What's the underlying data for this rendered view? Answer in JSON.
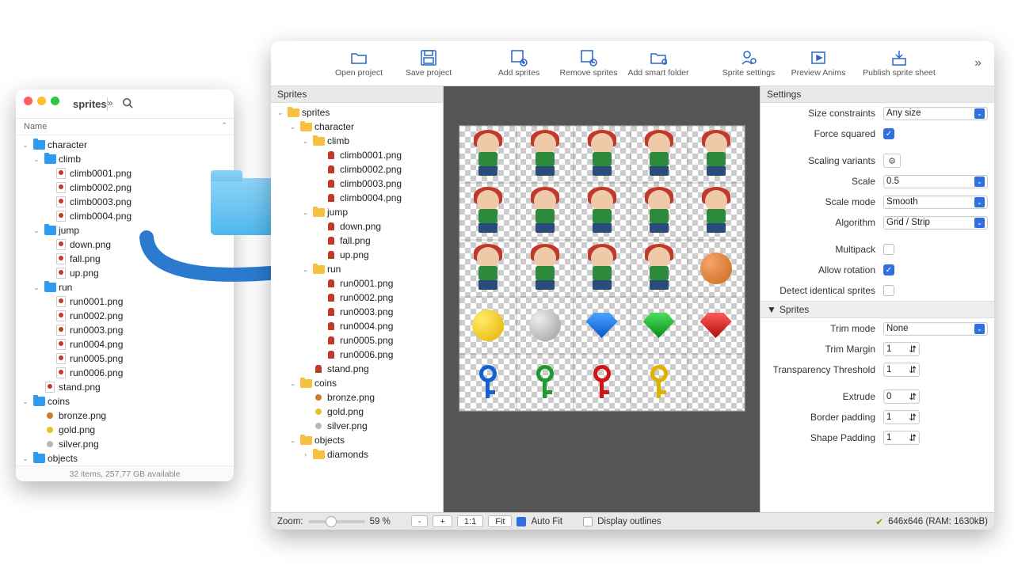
{
  "finder": {
    "title": "sprites",
    "name_header": "Name",
    "status": "32 items, 257,77 GB available",
    "tree": [
      {
        "d": 0,
        "t": "folder",
        "n": "character",
        "exp": 1
      },
      {
        "d": 1,
        "t": "folder",
        "n": "climb",
        "exp": 1
      },
      {
        "d": 2,
        "t": "png",
        "n": "climb0001.png"
      },
      {
        "d": 2,
        "t": "png",
        "n": "climb0002.png"
      },
      {
        "d": 2,
        "t": "png",
        "n": "climb0003.png"
      },
      {
        "d": 2,
        "t": "png",
        "n": "climb0004.png"
      },
      {
        "d": 1,
        "t": "folder",
        "n": "jump",
        "exp": 1
      },
      {
        "d": 2,
        "t": "png",
        "n": "down.png"
      },
      {
        "d": 2,
        "t": "png",
        "n": "fall.png"
      },
      {
        "d": 2,
        "t": "png",
        "n": "up.png"
      },
      {
        "d": 1,
        "t": "folder",
        "n": "run",
        "exp": 1
      },
      {
        "d": 2,
        "t": "png",
        "n": "run0001.png"
      },
      {
        "d": 2,
        "t": "png",
        "n": "run0002.png"
      },
      {
        "d": 2,
        "t": "png",
        "n": "run0003.png"
      },
      {
        "d": 2,
        "t": "png",
        "n": "run0004.png"
      },
      {
        "d": 2,
        "t": "png",
        "n": "run0005.png"
      },
      {
        "d": 2,
        "t": "png",
        "n": "run0006.png"
      },
      {
        "d": 1,
        "t": "png",
        "n": "stand.png"
      },
      {
        "d": 0,
        "t": "folder",
        "n": "coins",
        "exp": 1
      },
      {
        "d": 1,
        "t": "dot",
        "n": "bronze.png",
        "c": "#d07a2a"
      },
      {
        "d": 1,
        "t": "dot",
        "n": "gold.png",
        "c": "#e5c22a"
      },
      {
        "d": 1,
        "t": "dot",
        "n": "silver.png",
        "c": "#b8b8b8"
      },
      {
        "d": 0,
        "t": "folder",
        "n": "objects",
        "exp": 1
      }
    ]
  },
  "toolbar": {
    "open": "Open project",
    "save": "Save project",
    "add": "Add sprites",
    "remove": "Remove sprites",
    "smart": "Add smart folder",
    "settings": "Sprite settings",
    "preview": "Preview Anims",
    "publish": "Publish sprite sheet"
  },
  "sprites": {
    "header": "Sprites",
    "tree": [
      {
        "d": 0,
        "t": "folder",
        "n": "sprites",
        "exp": 1
      },
      {
        "d": 1,
        "t": "folder",
        "n": "character",
        "exp": 1
      },
      {
        "d": 2,
        "t": "folder",
        "n": "climb",
        "exp": 1
      },
      {
        "d": 3,
        "t": "sprite",
        "n": "climb0001.png"
      },
      {
        "d": 3,
        "t": "sprite",
        "n": "climb0002.png"
      },
      {
        "d": 3,
        "t": "sprite",
        "n": "climb0003.png"
      },
      {
        "d": 3,
        "t": "sprite",
        "n": "climb0004.png"
      },
      {
        "d": 2,
        "t": "folder",
        "n": "jump",
        "exp": 1
      },
      {
        "d": 3,
        "t": "sprite",
        "n": "down.png"
      },
      {
        "d": 3,
        "t": "sprite",
        "n": "fall.png"
      },
      {
        "d": 3,
        "t": "sprite",
        "n": "up.png"
      },
      {
        "d": 2,
        "t": "folder",
        "n": "run",
        "exp": 1
      },
      {
        "d": 3,
        "t": "sprite",
        "n": "run0001.png"
      },
      {
        "d": 3,
        "t": "sprite",
        "n": "run0002.png"
      },
      {
        "d": 3,
        "t": "sprite",
        "n": "run0003.png"
      },
      {
        "d": 3,
        "t": "sprite",
        "n": "run0004.png"
      },
      {
        "d": 3,
        "t": "sprite",
        "n": "run0005.png"
      },
      {
        "d": 3,
        "t": "sprite",
        "n": "run0006.png"
      },
      {
        "d": 2,
        "t": "sprite",
        "n": "stand.png"
      },
      {
        "d": 1,
        "t": "folder",
        "n": "coins",
        "exp": 1
      },
      {
        "d": 2,
        "t": "dot",
        "n": "bronze.png",
        "c": "#d07a2a"
      },
      {
        "d": 2,
        "t": "dot",
        "n": "gold.png",
        "c": "#e5c22a"
      },
      {
        "d": 2,
        "t": "dot",
        "n": "silver.png",
        "c": "#b8b8b8"
      },
      {
        "d": 1,
        "t": "folder",
        "n": "objects",
        "exp": 1
      },
      {
        "d": 2,
        "t": "folder",
        "n": "diamonds",
        "exp": 0
      }
    ]
  },
  "settings": {
    "header": "Settings",
    "size_constraints_lbl": "Size constraints",
    "size_constraints": "Any size",
    "force_squared_lbl": "Force squared",
    "force_squared": true,
    "scaling_variants_lbl": "Scaling variants",
    "scale_lbl": "Scale",
    "scale": "0.5",
    "scale_mode_lbl": "Scale mode",
    "scale_mode": "Smooth",
    "algorithm_lbl": "Algorithm",
    "algorithm": "Grid / Strip",
    "multipack_lbl": "Multipack",
    "multipack": false,
    "allow_rotation_lbl": "Allow rotation",
    "allow_rotation": true,
    "detect_identical_lbl": "Detect identical sprites",
    "detect_identical": false,
    "sprites_section": "Sprites",
    "trim_mode_lbl": "Trim mode",
    "trim_mode": "None",
    "trim_margin_lbl": "Trim Margin",
    "trim_margin": "1",
    "transparency_threshold_lbl": "Transparency Threshold",
    "transparency_threshold": "1",
    "extrude_lbl": "Extrude",
    "extrude": "0",
    "border_padding_lbl": "Border padding",
    "border_padding": "1",
    "shape_padding_lbl": "Shape Padding",
    "shape_padding": "1"
  },
  "footer": {
    "zoom_lbl": "Zoom:",
    "zoom_val": "59 %",
    "minus": "-",
    "plus": "+",
    "oneone": "1:1",
    "fit": "Fit",
    "autofit": "Auto Fit",
    "outlines": "Display outlines",
    "status": "646x646 (RAM: 1630kB)"
  }
}
